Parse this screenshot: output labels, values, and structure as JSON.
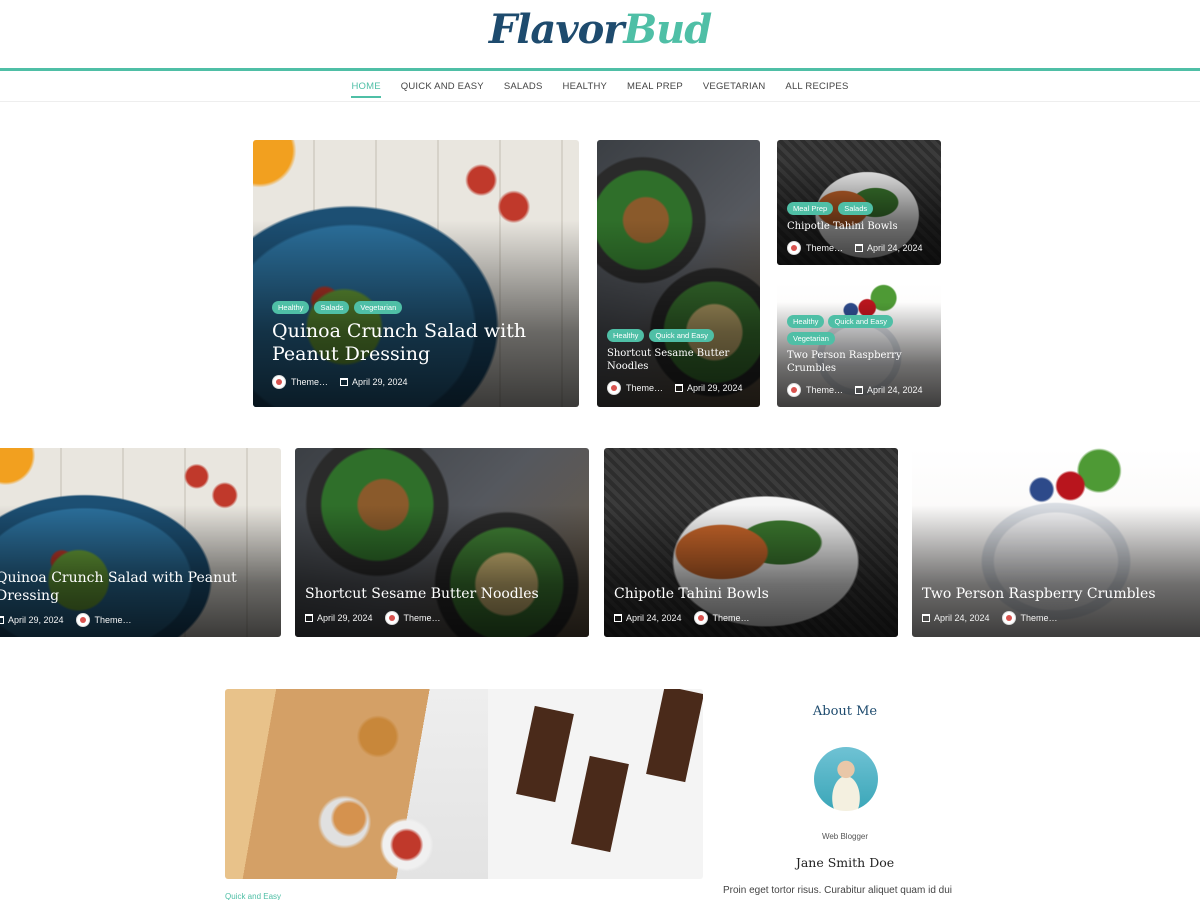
{
  "brand": {
    "logo_part1": "Flavor",
    "logo_part2": "Bud"
  },
  "nav": [
    {
      "label": "HOME"
    },
    {
      "label": "QUICK AND EASY"
    },
    {
      "label": "SALADS"
    },
    {
      "label": "HEALTHY"
    },
    {
      "label": "MEAL PREP"
    },
    {
      "label": "VEGETARIAN"
    },
    {
      "label": "ALL RECIPES"
    }
  ],
  "featured": {
    "main": {
      "tags": [
        "Healthy",
        "Salads",
        "Vegetarian"
      ],
      "title": "Quinoa Crunch Salad with Peanut Dressing",
      "author": "Theme…",
      "date": "April 29, 2024"
    },
    "middle": {
      "tags": [
        "Healthy",
        "Quick and Easy"
      ],
      "title": "Shortcut Sesame Butter Noodles",
      "author": "Theme…",
      "date": "April 29, 2024"
    },
    "right_top": {
      "tags": [
        "Meal Prep",
        "Salads"
      ],
      "title": "Chipotle Tahini Bowls",
      "author": "Theme…",
      "date": "April 24, 2024"
    },
    "right_bottom": {
      "tags": [
        "Healthy",
        "Quick and Easy",
        "Vegetarian"
      ],
      "title": "Two Person Raspberry Crumbles",
      "author": "Theme…",
      "date": "April 24, 2024"
    }
  },
  "slider": [
    {
      "title": "Quinoa Crunch Salad with Peanut Dressing",
      "date": "April 29, 2024",
      "author": "Theme…"
    },
    {
      "title": "Shortcut Sesame Butter Noodles",
      "date": "April 29, 2024",
      "author": "Theme…"
    },
    {
      "title": "Chipotle Tahini Bowls",
      "date": "April 24, 2024",
      "author": "Theme…"
    },
    {
      "title": "Two Person Raspberry Crumbles",
      "date": "April 24, 2024",
      "author": "Theme…"
    }
  ],
  "post": {
    "category": "Quick and Easy"
  },
  "about": {
    "title": "About Me",
    "role": "Web Blogger",
    "name": "Jane Smith Doe",
    "text": "Proin eget tortor risus. Curabitur aliquet quam id dui"
  },
  "colors": {
    "accent": "#4fbfa6",
    "brand_dark": "#1e4b6e"
  }
}
